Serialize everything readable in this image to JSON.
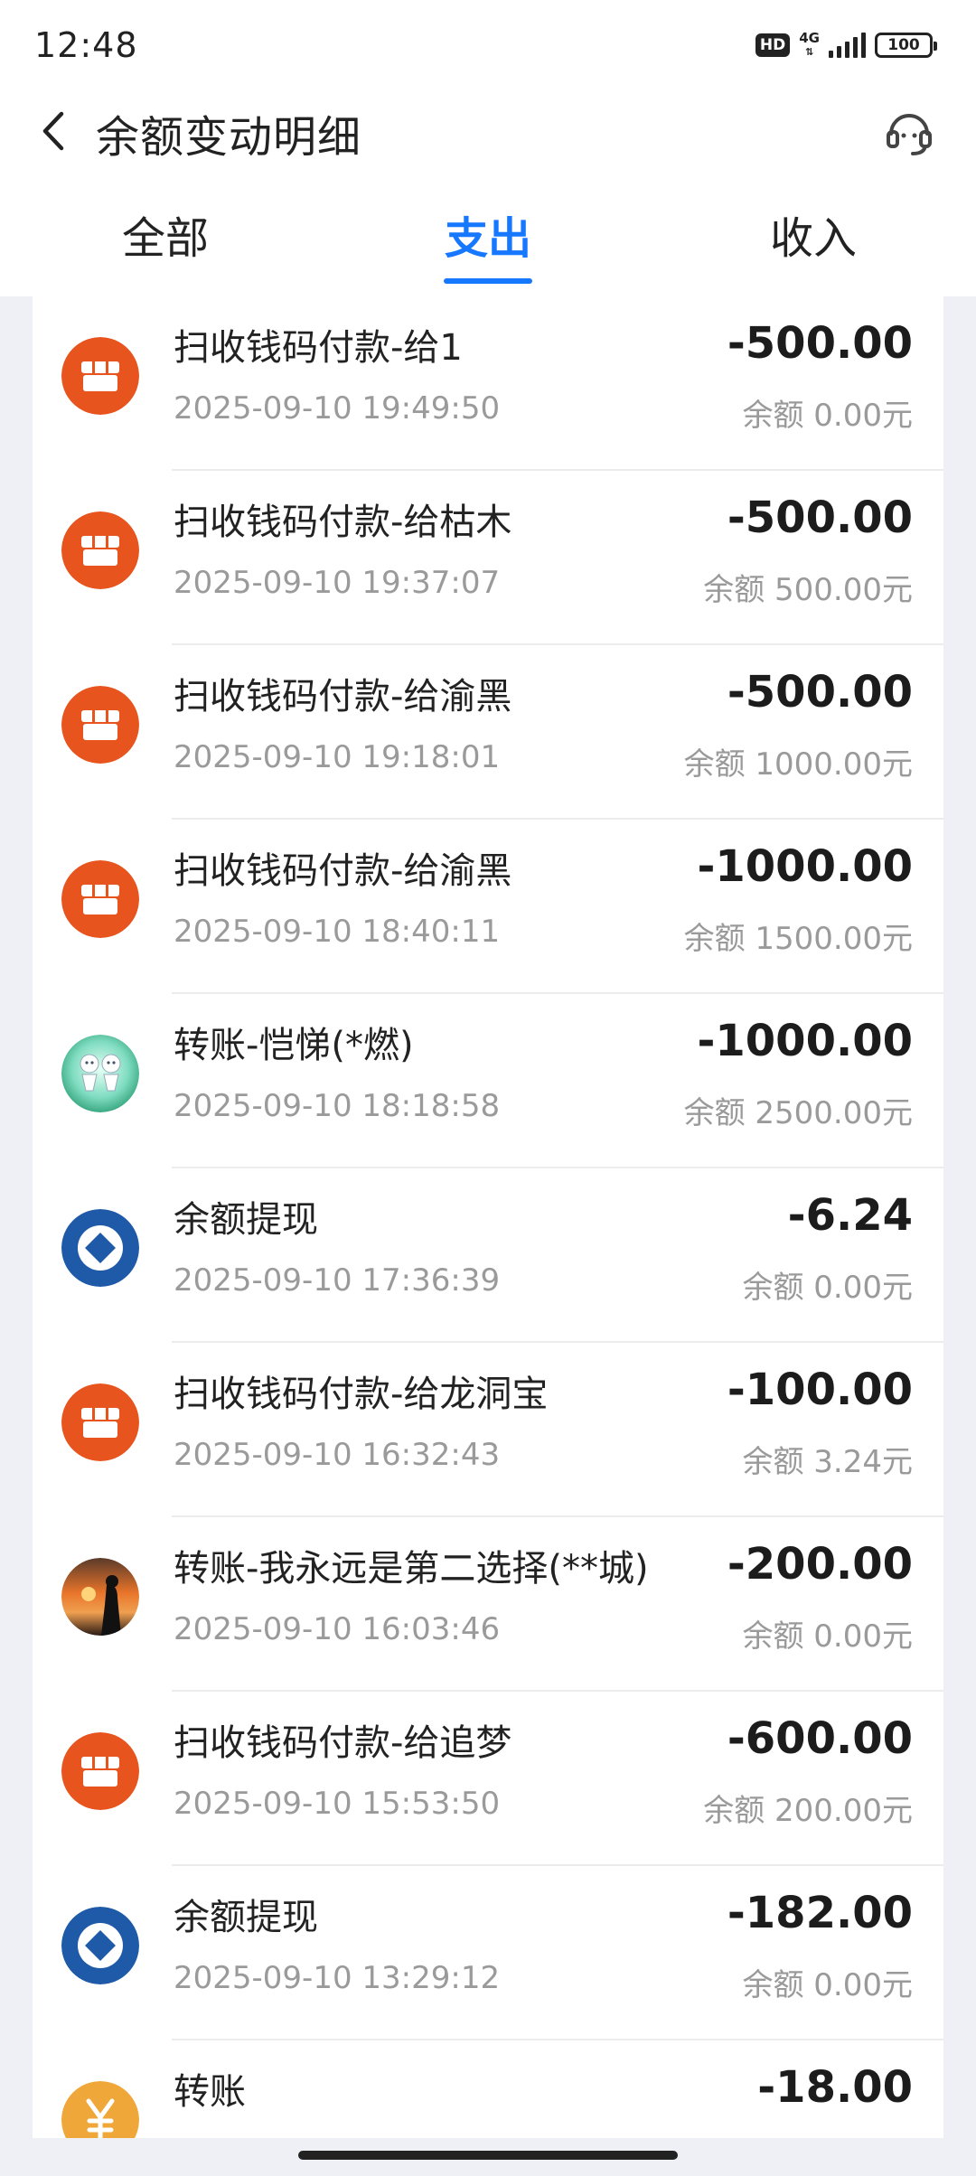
{
  "status_bar": {
    "time": "12:48",
    "hd": "HD",
    "network": "4G",
    "battery": "100"
  },
  "header": {
    "title": "余额变动明细",
    "back_icon": "chevron-left-icon",
    "service_icon": "headset-icon"
  },
  "tabs": [
    {
      "label": "全部",
      "active": false
    },
    {
      "label": "支出",
      "active": true
    },
    {
      "label": "收入",
      "active": false
    }
  ],
  "colors": {
    "accent": "#1677ff",
    "merchant_orange": "#e8541e",
    "bank_blue": "#1e5aa8",
    "transfer_yellow": "#f0a73a"
  },
  "transactions": [
    {
      "icon": "store-icon",
      "title": "扫收钱码付款-给1",
      "time": "2025-09-10 19:49:50",
      "amount": "-500.00",
      "balance": "余额 0.00元"
    },
    {
      "icon": "store-icon",
      "title": "扫收钱码付款-给枯木",
      "time": "2025-09-10 19:37:07",
      "amount": "-500.00",
      "balance": "余额 500.00元"
    },
    {
      "icon": "store-icon",
      "title": "扫收钱码付款-给渝黑",
      "time": "2025-09-10 19:18:01",
      "amount": "-500.00",
      "balance": "余额 1000.00元"
    },
    {
      "icon": "store-icon",
      "title": "扫收钱码付款-给渝黑",
      "time": "2025-09-10 18:40:11",
      "amount": "-1000.00",
      "balance": "余额 1500.00元"
    },
    {
      "icon": "avatar",
      "title": "转账-恺悌(*燃)",
      "time": "2025-09-10 18:18:58",
      "amount": "-1000.00",
      "balance": "余额 2500.00元"
    },
    {
      "icon": "bank-icon",
      "title": "余额提现",
      "time": "2025-09-10 17:36:39",
      "amount": "-6.24",
      "balance": "余额 0.00元"
    },
    {
      "icon": "store-icon",
      "title": "扫收钱码付款-给龙洞宝",
      "time": "2025-09-10 16:32:43",
      "amount": "-100.00",
      "balance": "余额 3.24元"
    },
    {
      "icon": "avatar",
      "title": "转账-我永远是第二选择(**城)",
      "time": "2025-09-10 16:03:46",
      "amount": "-200.00",
      "balance": "余额 0.00元"
    },
    {
      "icon": "store-icon",
      "title": "扫收钱码付款-给追梦",
      "time": "2025-09-10 15:53:50",
      "amount": "-600.00",
      "balance": "余额 200.00元"
    },
    {
      "icon": "bank-icon",
      "title": "余额提现",
      "time": "2025-09-10 13:29:12",
      "amount": "-182.00",
      "balance": "余额 0.00元"
    },
    {
      "icon": "yuan-icon",
      "title": "转账",
      "time": "",
      "amount": "-18.00",
      "balance": ""
    }
  ]
}
